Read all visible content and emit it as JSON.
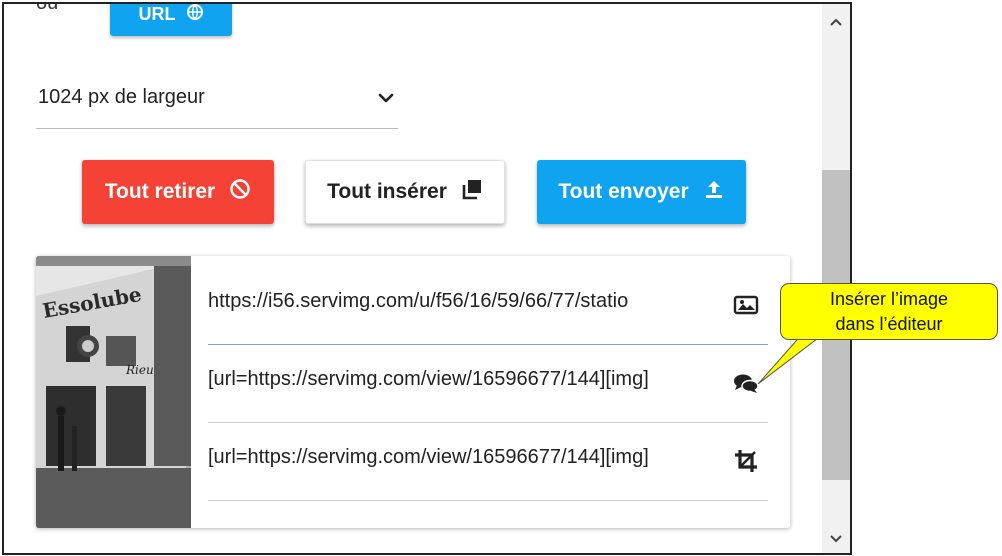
{
  "top": {
    "ou_label": "ou",
    "url_button_label": "URL"
  },
  "resize_select": {
    "value": "1024 px de largeur"
  },
  "actions": {
    "remove_all": "Tout retirer",
    "insert_all": "Tout insérer",
    "send_all": "Tout envoyer"
  },
  "image_card": {
    "thumbnail_sign_text": "Essolube",
    "thumbnail_sign_text_2": "Rieu",
    "links": [
      {
        "value": "https://i56.servimg.com/u/f56/16/59/66/77/statio",
        "icon": "image-icon"
      },
      {
        "value": "[url=https://servimg.com/view/16596677/144][img]",
        "icon": "comments-icon"
      },
      {
        "value": "[url=https://servimg.com/view/16596677/144][img]",
        "icon": "crop-icon"
      }
    ]
  },
  "callout": {
    "line1": "Insérer l’image",
    "line2": "dans l’éditeur"
  },
  "colors": {
    "red": "#f44336",
    "blue": "#0fa3f0",
    "callout_yellow": "#ffff00"
  }
}
